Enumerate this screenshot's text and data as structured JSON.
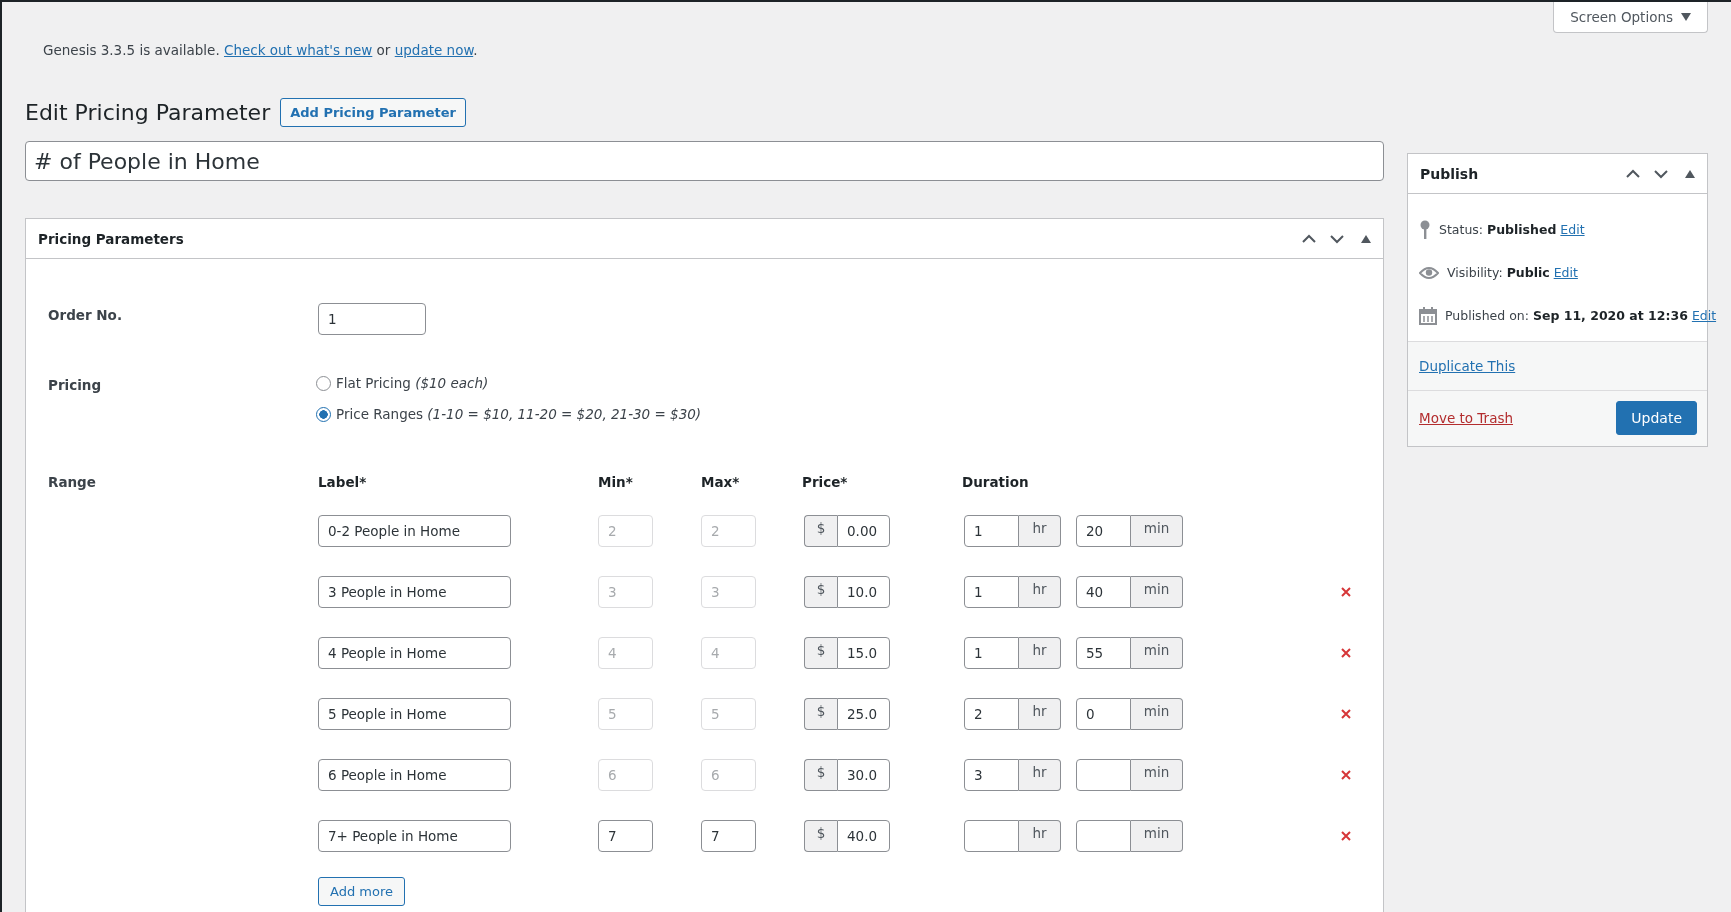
{
  "screen_options": {
    "label": "Screen Options"
  },
  "notice": {
    "text": "Genesis 3.3.5 is available.",
    "link_1": "Check out what's new",
    "middle": "or",
    "link_2": "update now",
    "end": "."
  },
  "heading": {
    "title": "Edit Pricing Parameter",
    "button": "Add Pricing Parameter"
  },
  "title_field": {
    "value": "# of People in Home"
  },
  "pricing_box": {
    "title": "Pricing Parameters",
    "order": {
      "label": "Order No.",
      "value": "1"
    },
    "pricing": {
      "label": "Pricing",
      "options": [
        {
          "label": "Flat Pricing",
          "note": "($10 each)",
          "selected": false
        },
        {
          "label": "Price Ranges",
          "note": "(1-10 = $10, 11-20 = $20, 21-30 = $30)",
          "selected": true
        }
      ]
    },
    "range": {
      "label": "Range",
      "columns": [
        "Label*",
        "Min*",
        "Max*",
        "Price*",
        "Duration"
      ],
      "rows": [
        {
          "label": "0-2 People in Home",
          "min": "2",
          "max": "2",
          "disabled": true,
          "currency": "$",
          "price": "0.00",
          "hours": "1",
          "hr_unit": "hr",
          "minutes": "20",
          "min_unit": "min",
          "removable": false
        },
        {
          "label": "3 People in Home",
          "min": "3",
          "max": "3",
          "disabled": true,
          "currency": "$",
          "price": "10.0",
          "hours": "1",
          "hr_unit": "hr",
          "minutes": "40",
          "min_unit": "min",
          "removable": true
        },
        {
          "label": "4 People in Home",
          "min": "4",
          "max": "4",
          "disabled": true,
          "currency": "$",
          "price": "15.0",
          "hours": "1",
          "hr_unit": "hr",
          "minutes": "55",
          "min_unit": "min",
          "removable": true
        },
        {
          "label": "5 People in Home",
          "min": "5",
          "max": "5",
          "disabled": true,
          "currency": "$",
          "price": "25.0",
          "hours": "2",
          "hr_unit": "hr",
          "minutes": "0",
          "min_unit": "min",
          "removable": true
        },
        {
          "label": "6 People in Home",
          "min": "6",
          "max": "6",
          "disabled": true,
          "currency": "$",
          "price": "30.0",
          "hours": "3",
          "hr_unit": "hr",
          "min_unit": "min",
          "removable": true
        },
        {
          "label": "7+ People in Home",
          "min": "7",
          "max": "7",
          "disabled": false,
          "currency": "$",
          "price": "40.0",
          "hr_unit": "hr",
          "min_unit": "min",
          "removable": true
        }
      ],
      "add_button": "Add more"
    }
  },
  "publish": {
    "title": "Publish",
    "meta": [
      {
        "kind": "status",
        "label": "Status:",
        "value": "Published",
        "link": "Edit"
      },
      {
        "kind": "visibility",
        "label": "Visibility:",
        "value": "Public",
        "link": "Edit"
      },
      {
        "kind": "date",
        "label": "Published on:",
        "value": "Sep 11, 2020 at 12:36",
        "link": "Edit"
      }
    ],
    "duplicate": "Duplicate This",
    "trash": "Move to Trash",
    "update": "Update"
  }
}
